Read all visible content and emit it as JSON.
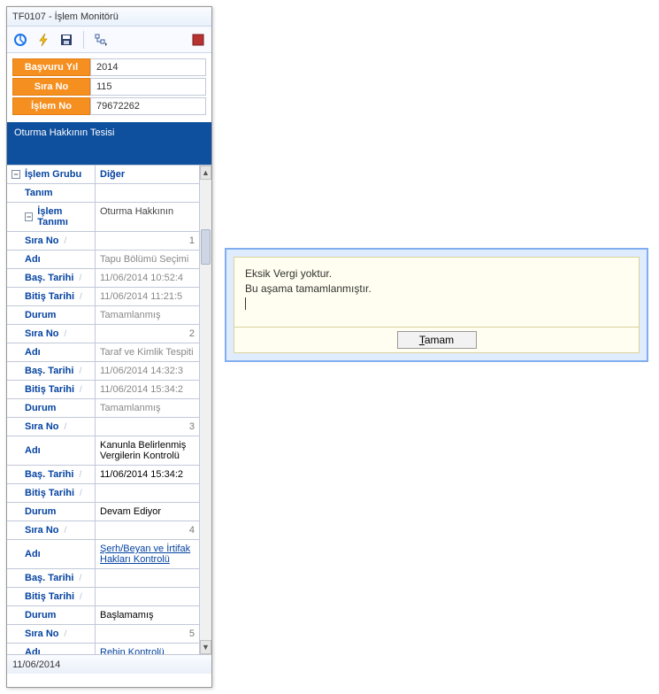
{
  "window": {
    "title": "TF0107 - İşlem Monitörü"
  },
  "header": {
    "basvuru_yil_label": "Başvuru Yıl",
    "basvuru_yil": "2014",
    "sira_no_label": "Sıra No",
    "sira_no": "115",
    "islem_no_label": "İşlem No",
    "islem_no": "79672262"
  },
  "banner": "Oturma Hakkının Tesisi",
  "grid": {
    "islem_grubu_label": "İşlem Grubu",
    "islem_grubu_value": "Diğer",
    "tanim_label": "Tanım",
    "islem_tanimi_label": "İşlem Tanımı",
    "islem_tanimi_value": "Oturma Hakkının",
    "labels": {
      "sira_no": "Sıra No",
      "adi": "Adı",
      "bas_tarihi": "Baş. Tarihi",
      "bitis_tarihi": "Bitiş Tarihi",
      "durum": "Durum"
    },
    "items": [
      {
        "sira_no": "1",
        "adi": "Tapu Bölümü Seçimi",
        "bas": "11/06/2014 10:52:4",
        "bitis": "11/06/2014 11:21:5",
        "durum": "Tamamlanmış",
        "gray": true
      },
      {
        "sira_no": "2",
        "adi": "Taraf ve Kimlik Tespiti",
        "bas": "11/06/2014 14:32:3",
        "bitis": "11/06/2014 15:34:2",
        "durum": "Tamamlanmış",
        "gray": true
      },
      {
        "sira_no": "3",
        "adi": "Kanunla Belirlenmiş Vergilerin Kontrolü",
        "bas": "11/06/2014 15:34:2",
        "bitis": "",
        "durum": "Devam Ediyor",
        "gray": false
      },
      {
        "sira_no": "4",
        "adi": "Şerh/Beyan ve İrtifak Hakları Kontrolü",
        "bas": "",
        "bitis": "",
        "durum": "Başlamamış",
        "gray": false,
        "link": true
      },
      {
        "sira_no": "5",
        "adi": "Rehin Kontrolü",
        "bas": "",
        "bitis": "",
        "durum": "",
        "gray": false,
        "link": true
      }
    ]
  },
  "statusbar": {
    "date": "11/06/2014"
  },
  "dialog": {
    "line1": "Eksik Vergi yoktur.",
    "line2": "Bu aşama tamamlanmıştır.",
    "btn_first": "T",
    "btn_rest": "amam"
  }
}
